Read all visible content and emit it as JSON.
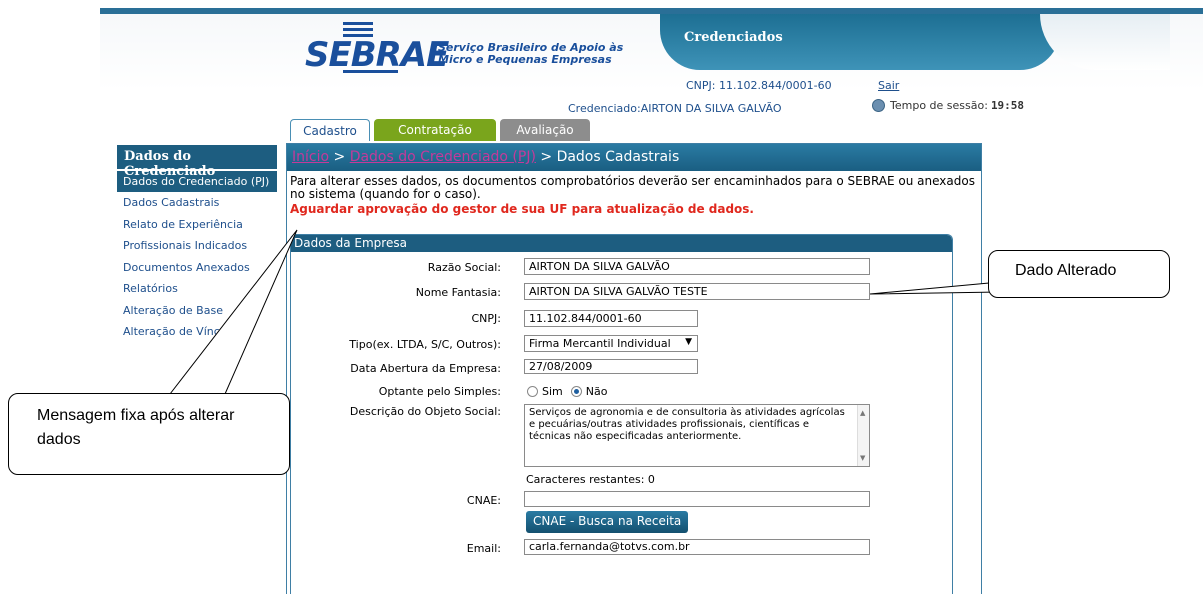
{
  "header": {
    "logo_text": "SEBRAE",
    "logo_subtitle_1": "Serviço Brasileiro de Apoio às",
    "logo_subtitle_2": "Micro e Pequenas Empresas",
    "app_title": "Credenciados",
    "cnpj_line": "CNPJ: 11.102.844/0001-60",
    "logout_label": "Sair",
    "credenciado_line": "Credenciado:AIRTON DA SILVA GALVÃO",
    "session_label": "Tempo de sessão:",
    "session_value": "19:58"
  },
  "tabs": [
    {
      "label": "Cadastro"
    },
    {
      "label": "Contratação"
    },
    {
      "label": "Avaliação"
    }
  ],
  "sidebar": {
    "title": "Dados do Credenciado",
    "selected": "Dados do Credenciado (PJ)",
    "items": [
      {
        "label": "Dados Cadastrais"
      },
      {
        "label": "Relato de Experiência"
      },
      {
        "label": "Profissionais Indicados"
      },
      {
        "label": "Documentos Anexados"
      },
      {
        "label": "Relatórios"
      },
      {
        "label": "Alteração de Base"
      },
      {
        "label": "Alteração de Vínculo"
      }
    ]
  },
  "breadcrumb": {
    "home": "Início",
    "sep1": " > ",
    "parent": "Dados do Credenciado (PJ)",
    "sep2": " > ",
    "current": "Dados Cadastrais"
  },
  "notice_text": "Para alterar esses dados, os documentos comprobatórios deverão ser encaminhados para o SEBRAE ou anexados no sistema (quando for o caso).",
  "warning_text": "Aguardar aprovação do gestor de sua UF para atualização de dados.",
  "form": {
    "section_title": "Dados da Empresa",
    "razao_label": "Razão Social:",
    "razao_value": "AIRTON DA SILVA GALVÃO",
    "fantasia_label": "Nome Fantasia:",
    "fantasia_value": "AIRTON DA SILVA GALVÃO  TESTE",
    "cnpj_label": "CNPJ:",
    "cnpj_value": "11.102.844/0001-60",
    "tipo_label": "Tipo(ex. LTDA, S/C, Outros):",
    "tipo_value": "Firma Mercantil Individual",
    "data_label": "Data Abertura da Empresa:",
    "data_value": "27/08/2009",
    "simples_label": "Optante pelo Simples:",
    "simples_sim": "Sim",
    "simples_nao": "Não",
    "objeto_label": "Descrição do Objeto Social:",
    "objeto_value": "Serviços de agronomia e de consultoria às atividades agrícolas e pecuárias/outras atividades profissionais, científicas e técnicas não especificadas anteriormente.",
    "restantes_label": "Caracteres restantes: 0",
    "cnae_label": "CNAE:",
    "cnae_value": "",
    "cnae_button": "CNAE - Busca na Receita",
    "email_label": "Email:",
    "email_value": "carla.fernanda@totvs.com.br"
  },
  "callouts": {
    "left": "Mensagem fixa após alterar dados",
    "right": "Dado Alterado"
  },
  "colors": {
    "brand_blue": "#1a4f9c",
    "header_teal": "#1d5d80",
    "warning_red": "#e0281e",
    "tab_green": "#7aa51c",
    "tab_gray": "#8d8d8d"
  }
}
